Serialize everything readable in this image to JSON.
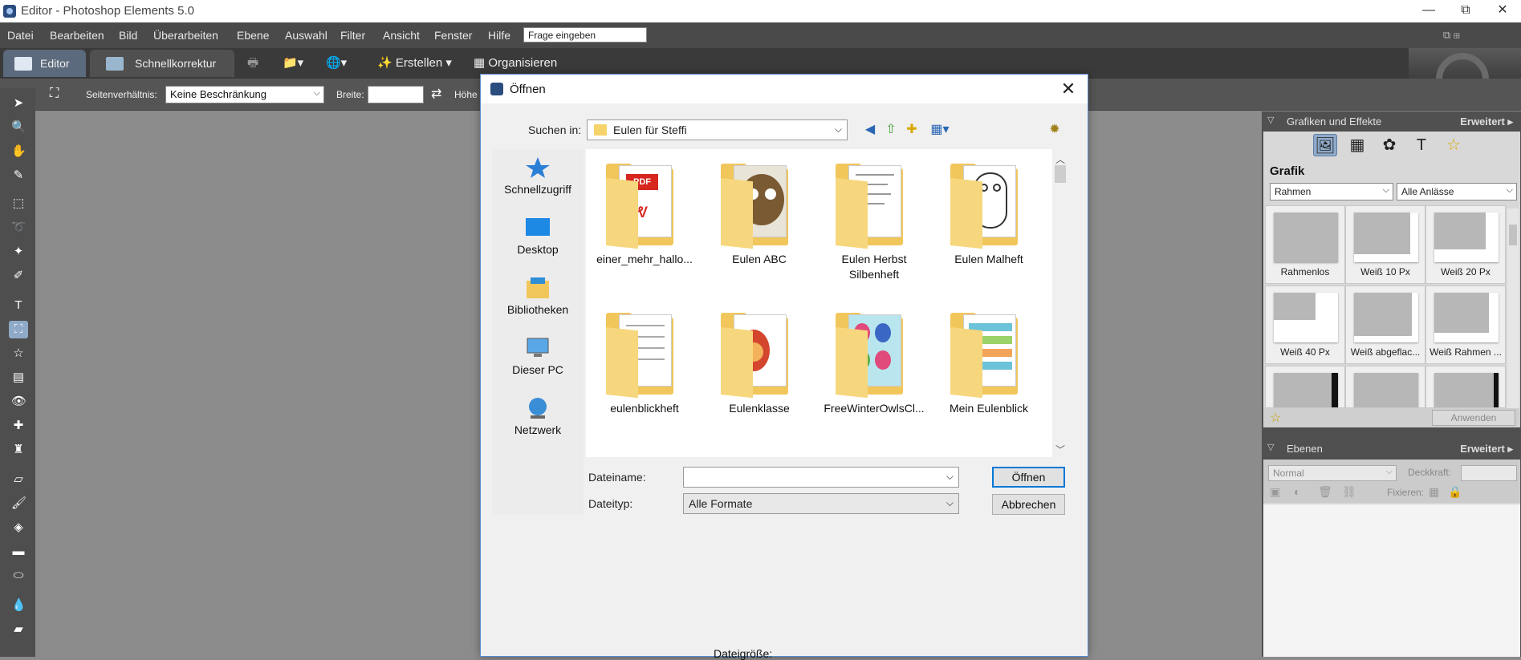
{
  "window": {
    "title": "Editor - Photoshop Elements 5.0",
    "min": "—",
    "restore": "⧉",
    "close": "✕"
  },
  "menu": {
    "items": [
      "Datei",
      "Bearbeiten",
      "Bild",
      "Überarbeiten",
      "Ebene",
      "Auswahl",
      "Filter",
      "Ansicht",
      "Fenster",
      "Hilfe"
    ],
    "ask_placeholder": "Frage eingeben"
  },
  "modebar": {
    "editor": "Editor",
    "quickfix": "Schnellkorrektur",
    "create": "Erstellen",
    "organize": "Organisieren"
  },
  "options": {
    "aspect_label": "Seitenverhältnis:",
    "aspect_value": "Keine Beschränkung",
    "width_label": "Breite:",
    "width_value": "",
    "height_label": "Höhe"
  },
  "effects_panel": {
    "title": "Grafiken und Effekte",
    "expand": "Erweitert ▸",
    "section": "Grafik",
    "category": "Rahmen",
    "occasion": "Alle Anlässe",
    "thumbs": [
      {
        "label": "Rahmenlos"
      },
      {
        "label": "Weiß 10 Px"
      },
      {
        "label": "Weiß 20 Px"
      },
      {
        "label": "Weiß 40 Px"
      },
      {
        "label": "Weiß abgeflac..."
      },
      {
        "label": "Weiß Rahmen ..."
      },
      {
        "label": ""
      },
      {
        "label": ""
      },
      {
        "label": ""
      }
    ],
    "apply": "Anwenden"
  },
  "layers_panel": {
    "title": "Ebenen",
    "expand": "Erweitert ▸",
    "blend_mode": "Normal",
    "opacity_label": "Deckkraft:",
    "lock_label": "Fixieren:"
  },
  "dialog": {
    "title": "Öffnen",
    "lookin_label": "Suchen in:",
    "lookin_value": "Eulen für Steffi",
    "places": [
      {
        "label": "Schnellzugriff",
        "icon": "star-icon"
      },
      {
        "label": "Desktop",
        "icon": "desktop-icon"
      },
      {
        "label": "Bibliotheken",
        "icon": "library-icon"
      },
      {
        "label": "Dieser PC",
        "icon": "computer-icon"
      },
      {
        "label": "Netzwerk",
        "icon": "network-icon"
      }
    ],
    "files": [
      {
        "name": "einer_mehr_hallo..."
      },
      {
        "name": "Eulen ABC"
      },
      {
        "name": "Eulen Herbst Silbenheft"
      },
      {
        "name": "Eulen Malheft"
      },
      {
        "name": "eulenblickheft"
      },
      {
        "name": "Eulenklasse"
      },
      {
        "name": "FreeWinterOwlsCl..."
      },
      {
        "name": "Mein Eulenblick"
      }
    ],
    "filename_label": "Dateiname:",
    "filename_value": "",
    "filetype_label": "Dateityp:",
    "filetype_value": "Alle Formate",
    "open_button": "Öffnen",
    "cancel_button": "Abbrechen",
    "filesize_label": "Dateigröße:",
    "pdf_badge": "PDF"
  },
  "colors": {
    "accent": "#0078d7",
    "folder": "#f1c65b",
    "menubar": "#4a4a4a",
    "canvas": "#8c8c8c"
  }
}
